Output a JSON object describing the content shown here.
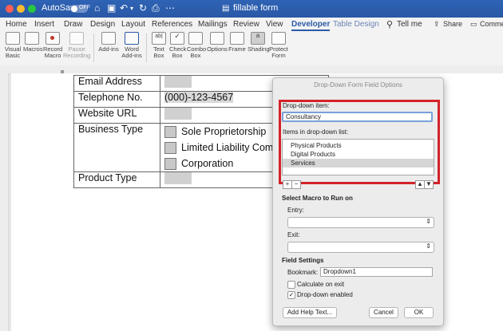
{
  "titlebar": {
    "autosave_label": "AutoSave",
    "autosave_state": "OFF",
    "doc_title": "fillable form"
  },
  "tabs": [
    "Home",
    "Insert",
    "Draw",
    "Design",
    "Layout",
    "References",
    "Mailings",
    "Review",
    "View",
    "Developer",
    "Table Design"
  ],
  "tell_me": "Tell me",
  "share_label": "Share",
  "comments_label": "Comme",
  "ribbon": {
    "visual_basic": "Visual\nBasic",
    "macros": "Macros",
    "record_macro": "Record\nMacro",
    "pause_recording": "Pause\nRecording",
    "add_ins": "Add-ins",
    "word_add_ins": "Word\nAdd-ins",
    "text_box": "Text\nBox",
    "check_box": "Check\nBox",
    "combo_box": "Combo\nBox",
    "options": "Options",
    "frame": "Frame",
    "shading": "Shading",
    "protect_form": "Protect\nForm"
  },
  "form": {
    "email_label": "Email Address",
    "telephone_label": "Telephone No.",
    "telephone_value": "(000)-123-4567",
    "website_label": "Website URL",
    "business_type_label": "Business Type",
    "option_1": "Sole Proprietorship",
    "option_2": "Limited Liability Com",
    "option_3": "Corporation",
    "product_type_label": "Product Type"
  },
  "dialog": {
    "title": "Drop-Down Form Field Options",
    "dropdown_item_label": "Drop-down item:",
    "dropdown_item_value": "Consultancy",
    "items_list_label": "Items in drop-down list:",
    "items": [
      "Physical Products",
      "Digital Products",
      "Services"
    ],
    "selected_item": "Services",
    "add_symbol": "+",
    "remove_symbol": "−",
    "move_up_symbol": "▲",
    "move_down_symbol": "▼",
    "macro_section": "Select Macro to Run on",
    "entry_label": "Entry:",
    "exit_label": "Exit:",
    "field_settings": "Field Settings",
    "bookmark_label": "Bookmark:",
    "bookmark_value": "Dropdown1",
    "calculate_label": "Calculate on exit",
    "calculate_checked": false,
    "enabled_label": "Drop-down enabled",
    "enabled_checked": true,
    "help_button": "Add Help Text...",
    "cancel_button": "Cancel",
    "ok_button": "OK"
  },
  "colors": {
    "titlebar": "#2958a6",
    "accent": "#2a5aa7",
    "highlight_border": "#d3232a"
  }
}
